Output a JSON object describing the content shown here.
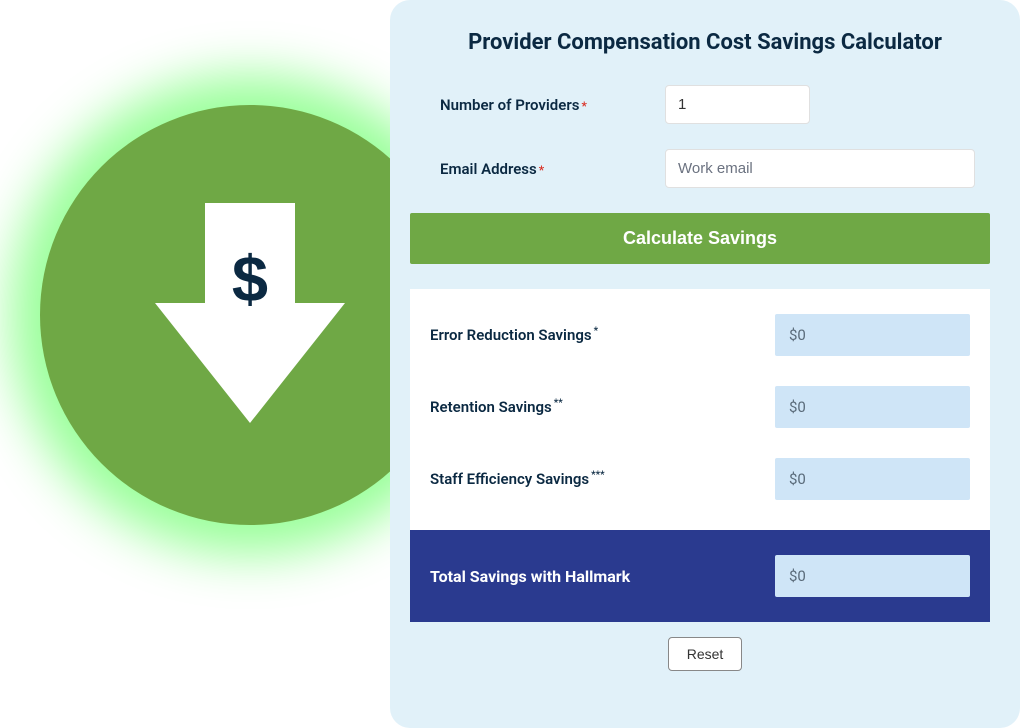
{
  "title": "Provider Compensation Cost Savings Calculator",
  "inputs": {
    "providers_label": "Number of Providers",
    "providers_value": "1",
    "email_label": "Email Address",
    "email_placeholder": "Work email"
  },
  "calc_button_label": "Calculate Savings",
  "results": {
    "error_reduction": {
      "label": "Error Reduction Savings",
      "note": "*",
      "value": "$0"
    },
    "retention": {
      "label": "Retention Savings",
      "note": "**",
      "value": "$0"
    },
    "staff_efficiency": {
      "label": "Staff Efficiency Savings",
      "note": "***",
      "value": "$0"
    },
    "total": {
      "label": "Total Savings with Hallmark",
      "value": "$0"
    }
  },
  "reset_label": "Reset"
}
